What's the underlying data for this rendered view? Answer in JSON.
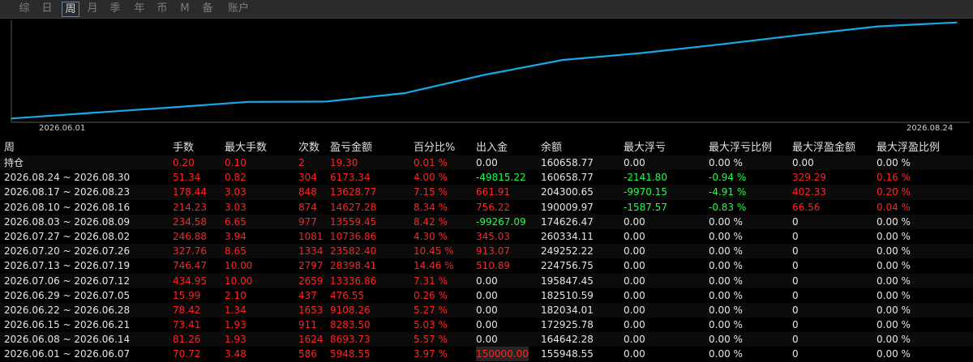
{
  "tabs": [
    "综",
    "日",
    "周",
    "月",
    "季",
    "年",
    "币",
    "M",
    "备",
    "账户"
  ],
  "active_tab": 2,
  "chart_data": {
    "type": "line",
    "x_start_label": "2026.06.01",
    "x_end_label": "2026.08.24",
    "x": [
      "2026.06.01",
      "2026.06.08",
      "2026.06.15",
      "2026.06.22",
      "2026.06.29",
      "2026.07.06",
      "2026.07.13",
      "2026.07.20",
      "2026.07.27",
      "2026.08.03",
      "2026.08.10",
      "2026.08.17",
      "2026.08.24"
    ],
    "values": [
      5948.55,
      14642.28,
      22925.78,
      32034.01,
      32510.59,
      45847.45,
      74245.86,
      97828.26,
      108565.12,
      122124.57,
      136751.85,
      150380.62,
      156553.96
    ],
    "color": "#18a8e8",
    "grid": false
  },
  "columns": [
    "周",
    "手数",
    "最大手数",
    "次数",
    "盈亏金额",
    "百分比%",
    "出入金",
    "余额",
    "最大浮亏",
    "最大浮亏比例",
    "最大浮盈金额",
    "最大浮盈比例"
  ],
  "rows": [
    {
      "c": [
        "持仓",
        "0.20",
        "0.10",
        "2",
        "19.30",
        "0.01 %",
        "0.00",
        "160658.77",
        "0.00",
        "0.00 %",
        "0.00",
        "0.00 %"
      ],
      "k": [
        "w",
        "r",
        "r",
        "r",
        "r",
        "r",
        "w",
        "w",
        "w",
        "w",
        "w",
        "w"
      ]
    },
    {
      "c": [
        "2026.08.24 ~ 2026.08.30",
        "51.34",
        "0.82",
        "304",
        "6173.34",
        "4.00 %",
        "-49815.22",
        "160658.77",
        "-2141.80",
        "-0.94 %",
        "329.29",
        "0.16 %"
      ],
      "k": [
        "w",
        "r",
        "r",
        "r",
        "r",
        "r",
        "g",
        "w",
        "g",
        "g",
        "r",
        "r"
      ]
    },
    {
      "c": [
        "2026.08.17 ~ 2026.08.23",
        "178.44",
        "3.03",
        "848",
        "13628.77",
        "7.15 %",
        "661.91",
        "204300.65",
        "-9970.15",
        "-4.91 %",
        "402.33",
        "0.20 %"
      ],
      "k": [
        "w",
        "r",
        "r",
        "r",
        "r",
        "r",
        "r",
        "w",
        "g",
        "g",
        "r",
        "r"
      ]
    },
    {
      "c": [
        "2026.08.10 ~ 2026.08.16",
        "214.23",
        "3.03",
        "874",
        "14627.28",
        "8.34 %",
        "756.22",
        "190009.97",
        "-1587.57",
        "-0.83 %",
        "66.56",
        "0.04 %"
      ],
      "k": [
        "w",
        "r",
        "r",
        "r",
        "r",
        "r",
        "r",
        "w",
        "g",
        "g",
        "r",
        "r"
      ]
    },
    {
      "c": [
        "2026.08.03 ~ 2026.08.09",
        "234.58",
        "6.65",
        "977",
        "13559.45",
        "8.42 %",
        "-99267.09",
        "174626.47",
        "0.00",
        "0.00 %",
        "0",
        "0.00 %"
      ],
      "k": [
        "w",
        "r",
        "r",
        "r",
        "r",
        "r",
        "g",
        "w",
        "w",
        "w",
        "w",
        "w"
      ]
    },
    {
      "c": [
        "2026.07.27 ~ 2026.08.02",
        "246.88",
        "3.94",
        "1081",
        "10736.86",
        "4.30 %",
        "345.03",
        "260334.11",
        "0.00",
        "0.00 %",
        "0",
        "0.00 %"
      ],
      "k": [
        "w",
        "r",
        "r",
        "r",
        "r",
        "r",
        "r",
        "w",
        "w",
        "w",
        "w",
        "w"
      ]
    },
    {
      "c": [
        "2026.07.20 ~ 2026.07.26",
        "327.76",
        "8.65",
        "1334",
        "23582.40",
        "10.45 %",
        "913.07",
        "249252.22",
        "0.00",
        "0.00 %",
        "0",
        "0.00 %"
      ],
      "k": [
        "w",
        "r",
        "r",
        "r",
        "r",
        "r",
        "r",
        "w",
        "w",
        "w",
        "w",
        "w"
      ]
    },
    {
      "c": [
        "2026.07.13 ~ 2026.07.19",
        "746.47",
        "10.00",
        "2797",
        "28398.41",
        "14.46 %",
        "510.89",
        "224756.75",
        "0.00",
        "0.00 %",
        "0",
        "0.00 %"
      ],
      "k": [
        "w",
        "r",
        "r",
        "r",
        "r",
        "r",
        "r",
        "w",
        "w",
        "w",
        "w",
        "w"
      ]
    },
    {
      "c": [
        "2026.07.06 ~ 2026.07.12",
        "434.95",
        "10.00",
        "2659",
        "13336.86",
        "7.31 %",
        "0.00",
        "195847.45",
        "0.00",
        "0.00 %",
        "0",
        "0.00 %"
      ],
      "k": [
        "w",
        "r",
        "r",
        "r",
        "r",
        "r",
        "w",
        "w",
        "w",
        "w",
        "w",
        "w"
      ]
    },
    {
      "c": [
        "2026.06.29 ~ 2026.07.05",
        "15.99",
        "2.10",
        "437",
        "476.55",
        "0.26 %",
        "0.00",
        "182510.59",
        "0.00",
        "0.00 %",
        "0",
        "0.00 %"
      ],
      "k": [
        "w",
        "r",
        "r",
        "r",
        "r",
        "r",
        "w",
        "w",
        "w",
        "w",
        "w",
        "w"
      ]
    },
    {
      "c": [
        "2026.06.22 ~ 2026.06.28",
        "78.42",
        "1.34",
        "1653",
        "9108.26",
        "5.27 %",
        "0.00",
        "182034.01",
        "0.00",
        "0.00 %",
        "0",
        "0.00 %"
      ],
      "k": [
        "w",
        "r",
        "r",
        "r",
        "r",
        "r",
        "w",
        "w",
        "w",
        "w",
        "w",
        "w"
      ]
    },
    {
      "c": [
        "2026.06.15 ~ 2026.06.21",
        "73.41",
        "1.93",
        "911",
        "8283.50",
        "5.03 %",
        "0.00",
        "172925.78",
        "0.00",
        "0.00 %",
        "0",
        "0.00 %"
      ],
      "k": [
        "w",
        "r",
        "r",
        "r",
        "r",
        "r",
        "w",
        "w",
        "w",
        "w",
        "w",
        "w"
      ]
    },
    {
      "c": [
        "2026.06.08 ~ 2026.06.14",
        "81.26",
        "1.93",
        "1624",
        "8693.73",
        "5.57 %",
        "0.00",
        "164642.28",
        "0.00",
        "0.00 %",
        "0",
        "0.00 %"
      ],
      "k": [
        "w",
        "r",
        "r",
        "r",
        "r",
        "r",
        "w",
        "w",
        "w",
        "w",
        "w",
        "w"
      ]
    },
    {
      "c": [
        "2026.06.01 ~ 2026.06.07",
        "70.72",
        "3.48",
        "586",
        "5948.55",
        "3.97 %",
        "150000.00",
        "155948.55",
        "0.00",
        "0.00 %",
        "0",
        "0.00 %"
      ],
      "k": [
        "w",
        "r",
        "r",
        "r",
        "r",
        "r",
        "r",
        "w",
        "w",
        "w",
        "w",
        "w"
      ]
    }
  ]
}
